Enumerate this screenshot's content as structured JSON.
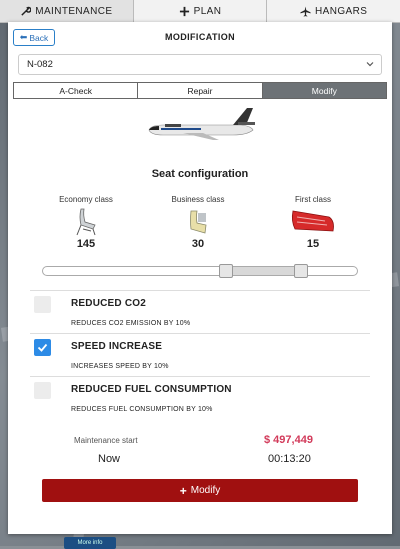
{
  "tabs": [
    {
      "label": "MAINTENANCE",
      "icon": "wrench-icon"
    },
    {
      "label": "PLAN",
      "icon": "plus-icon"
    },
    {
      "label": "HANGARS",
      "icon": "airplane-icon"
    }
  ],
  "header": {
    "back_label": "Back",
    "title": "MODIFICATION"
  },
  "aircraft_select": {
    "value": "N-082"
  },
  "modes": [
    "A-Check",
    "Repair",
    "Modify"
  ],
  "active_mode": "Modify",
  "seats": {
    "title": "Seat configuration",
    "classes": [
      {
        "label": "Economy class",
        "count": "145"
      },
      {
        "label": "Business class",
        "count": "30"
      },
      {
        "label": "First class",
        "count": "15"
      }
    ]
  },
  "options": [
    {
      "name": "REDUCED CO2",
      "desc": "REDUCES CO2 EMISSION BY 10%",
      "checked": false
    },
    {
      "name": "SPEED INCREASE",
      "desc": "INCREASES SPEED BY 10%",
      "checked": true
    },
    {
      "name": "REDUCED FUEL CONSUMPTION",
      "desc": "REDUCES FUEL CONSUMPTION BY 10%",
      "checked": false
    }
  ],
  "summary": {
    "maintenance_label": "Maintenance start",
    "price": "$ 497,449",
    "start": "Now",
    "duration": "00:13:20"
  },
  "action": {
    "label": "Modify"
  },
  "background": {
    "more_info": "More info"
  },
  "colors": {
    "accent": "#2d8be6",
    "danger": "#a01010",
    "price": "#d23a5a"
  }
}
